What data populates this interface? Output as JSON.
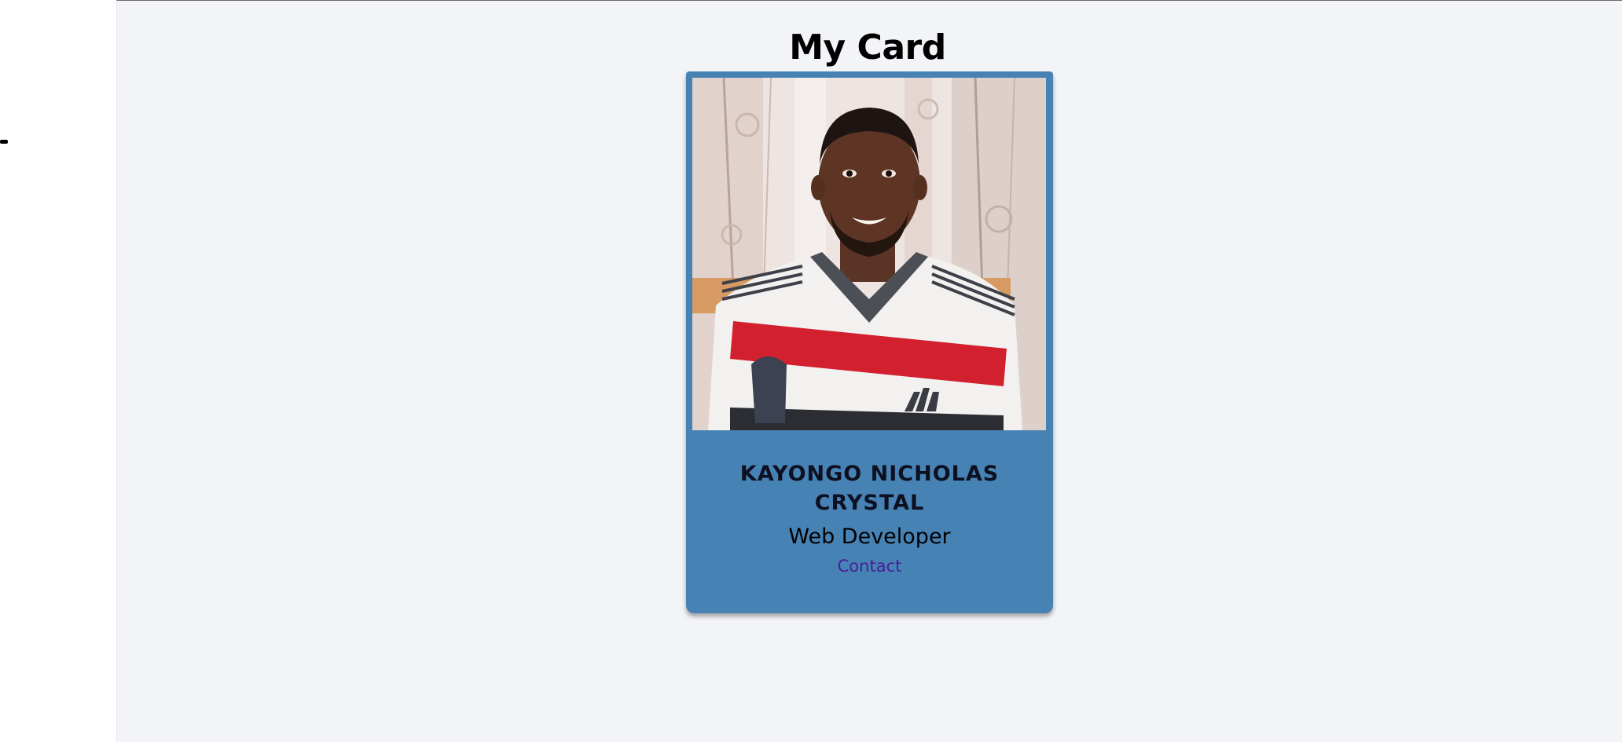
{
  "page": {
    "title": "My Card"
  },
  "card": {
    "name": "KAYONGO NICHOLAS CRYSTAL",
    "role": "Web Developer",
    "contact_label": "Contact",
    "photo_icon": "profile-photo",
    "background_color": "#4682b4"
  },
  "colors": {
    "page_background": "#f3f4f8",
    "card_background": "#4682b4",
    "link": "#4b1d9c"
  }
}
